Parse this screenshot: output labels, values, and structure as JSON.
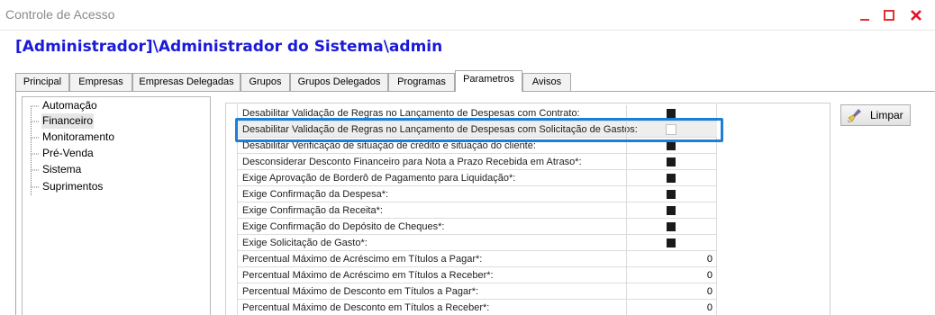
{
  "window": {
    "title": "Controle de Acesso",
    "header": "[Administrador]\\Administrador do Sistema\\admin"
  },
  "tabs": [
    {
      "label": "Principal",
      "active": false
    },
    {
      "label": "Empresas",
      "active": false
    },
    {
      "label": "Empresas Delegadas",
      "active": false
    },
    {
      "label": "Grupos",
      "active": false
    },
    {
      "label": "Grupos Delegados",
      "active": false
    },
    {
      "label": "Programas",
      "active": false
    },
    {
      "label": "Parametros",
      "active": true
    },
    {
      "label": "Avisos",
      "active": false
    }
  ],
  "tree": {
    "items": [
      {
        "label": "Automação",
        "selected": false
      },
      {
        "label": "Financeiro",
        "selected": true
      },
      {
        "label": "Monitoramento",
        "selected": false
      },
      {
        "label": "Pré-Venda",
        "selected": false
      },
      {
        "label": "Sistema",
        "selected": false
      },
      {
        "label": "Suprimentos",
        "selected": false
      }
    ]
  },
  "grid": {
    "rows": [
      {
        "label": "Desabilitar Validação de Regras no Lançamento de Despesas com Contrato:",
        "type": "check",
        "checked": true
      },
      {
        "label": "Desabilitar Validação de Regras no Lançamento de Despesas com Solicitação de Gastos:",
        "type": "check",
        "checked": false,
        "selected": true
      },
      {
        "label": "Desabilitar Verificação de situação de crédito e situação do cliente:",
        "type": "check",
        "checked": true
      },
      {
        "label": "Desconsiderar Desconto Financeiro para Nota a Prazo Recebida em Atraso*:",
        "type": "check",
        "checked": true
      },
      {
        "label": "Exige Aprovação de Borderô de Pagamento para Liquidação*:",
        "type": "check",
        "checked": true
      },
      {
        "label": "Exige Confirmação da Despesa*:",
        "type": "check",
        "checked": true
      },
      {
        "label": "Exige Confirmação da Receita*:",
        "type": "check",
        "checked": true
      },
      {
        "label": "Exige Confirmação do Depósito de Cheques*:",
        "type": "check",
        "checked": true
      },
      {
        "label": "Exige Solicitação de Gasto*:",
        "type": "check",
        "checked": true
      },
      {
        "label": "Percentual Máximo de Acréscimo em Títulos a Pagar*:",
        "type": "number",
        "value": "0"
      },
      {
        "label": "Percentual Máximo de Acréscimo em Títulos a Receber*:",
        "type": "number",
        "value": "0"
      },
      {
        "label": "Percentual Máximo de Desconto em Títulos a Pagar*:",
        "type": "number",
        "value": "0"
      },
      {
        "label": "Percentual Máximo de Desconto em Títulos a Receber*:",
        "type": "number",
        "value": "0"
      }
    ]
  },
  "buttons": {
    "limpar": "Limpar"
  },
  "colors": {
    "header": "#1a1ad8",
    "highlight": "#1e7fd8",
    "close_button": "#e81123"
  },
  "icons": [
    "minimize-icon",
    "maximize-icon",
    "close-icon",
    "broom-icon",
    "checkbox-icon"
  ]
}
